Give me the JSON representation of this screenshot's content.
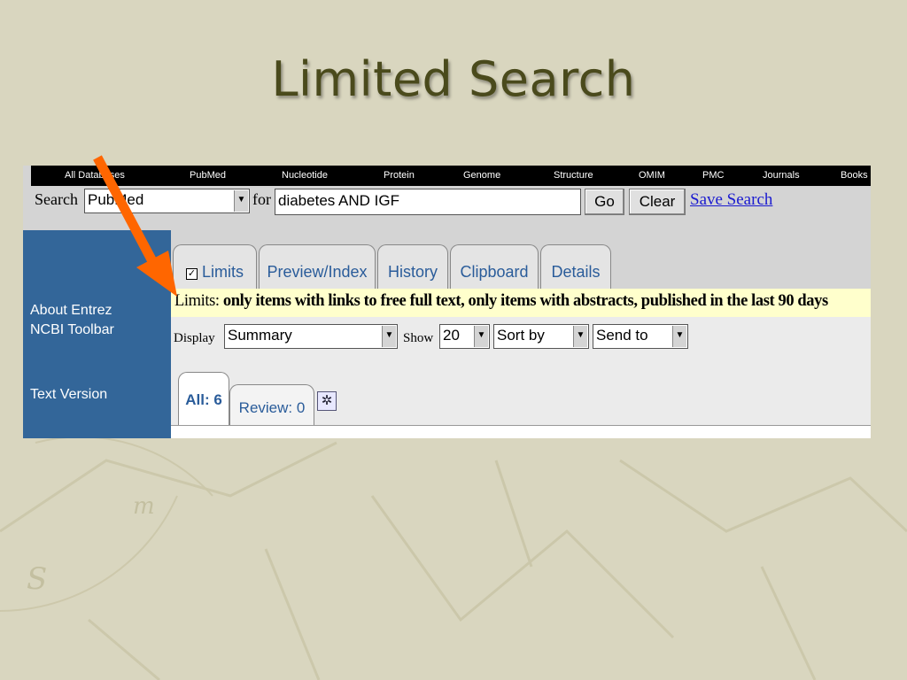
{
  "slide": {
    "title": "Limited Search"
  },
  "dbbar": {
    "items": [
      "All Databases",
      "PubMed",
      "Nucleotide",
      "Protein",
      "Genome",
      "Structure",
      "OMIM",
      "PMC",
      "Journals",
      "Books"
    ]
  },
  "search": {
    "label": "Search",
    "database_value": "PubMed",
    "for_label": "for",
    "query": "diabetes AND IGF",
    "go": "Go",
    "clear": "Clear",
    "save": "Save Search"
  },
  "sidebar": {
    "items": [
      "About Entrez",
      "NCBI Toolbar",
      "Text Version"
    ]
  },
  "tabs": {
    "items": [
      {
        "label": "Limits",
        "checked": true
      },
      {
        "label": "Preview/Index"
      },
      {
        "label": "History"
      },
      {
        "label": "Clipboard"
      },
      {
        "label": "Details"
      }
    ]
  },
  "limits": {
    "prefix": "Limits:",
    "text": "only items with links to free full text, only items with abstracts, published in the last 90 days"
  },
  "display": {
    "label": "Display",
    "format": "Summary",
    "show_label": "Show",
    "count": "20",
    "sort": "Sort by",
    "send": "Send to"
  },
  "results_tabs": {
    "all": "All: 6",
    "review": "Review: 0"
  },
  "colors": {
    "slide_bg": "#d9d6bf",
    "title": "#4a4a1c",
    "sidebar": "#336699",
    "limits_bg": "#ffffcc",
    "arrow": "#ff6600",
    "link": "#1a1ad0"
  },
  "icons": {
    "tool": "wrench-icon",
    "checkbox": "checkbox-checked-icon",
    "dropdown": "dropdown-arrow-icon"
  }
}
